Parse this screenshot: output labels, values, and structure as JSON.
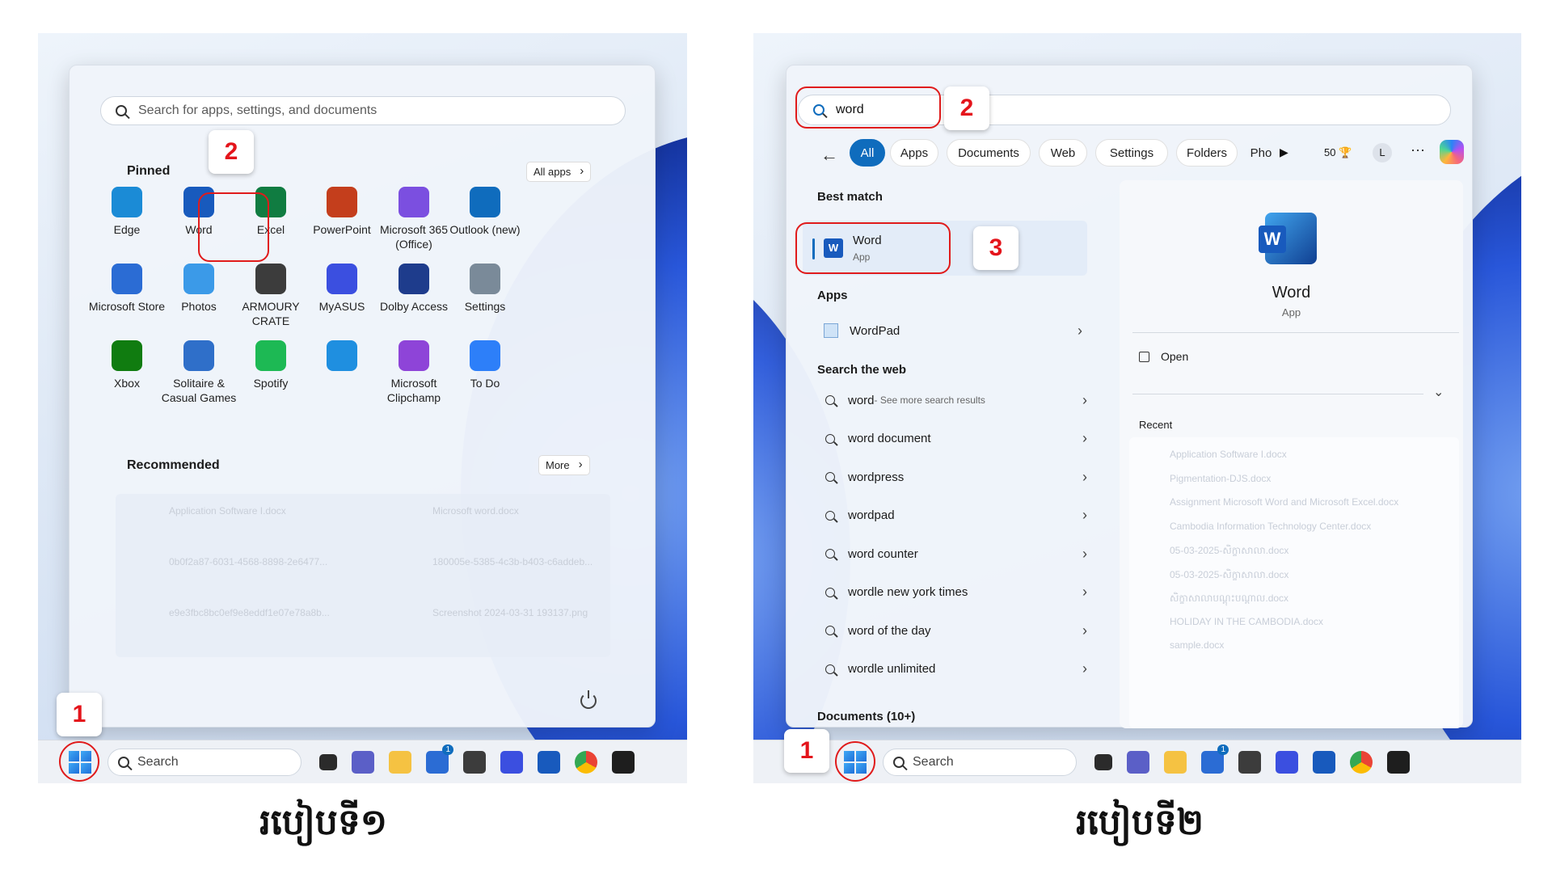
{
  "left": {
    "search_placeholder": "Search for apps, settings, and documents",
    "pinned_label": "Pinned",
    "all_apps_label": "All apps",
    "pinned_apps": [
      {
        "label": "Edge",
        "icon": "edge-icon",
        "color": "#1b8bd6"
      },
      {
        "label": "Word",
        "icon": "word-icon",
        "color": "#185abd"
      },
      {
        "label": "Excel",
        "icon": "excel-icon",
        "color": "#107c41"
      },
      {
        "label": "PowerPoint",
        "icon": "powerpoint-icon",
        "color": "#c43e1c"
      },
      {
        "label": "Microsoft 365 (Office)",
        "icon": "m365-icon",
        "color": "#7b4fe0"
      },
      {
        "label": "Outlook (new)",
        "icon": "outlook-icon",
        "color": "#0f6cbd"
      },
      {
        "label": "Microsoft Store",
        "icon": "store-icon",
        "color": "#2b6cd4"
      },
      {
        "label": "Photos",
        "icon": "photos-icon",
        "color": "#3b9ae8"
      },
      {
        "label": "ARMOURY CRATE",
        "icon": "armoury-icon",
        "color": "#3c3c3c"
      },
      {
        "label": "MyASUS",
        "icon": "myasus-icon",
        "color": "#3b4fe0"
      },
      {
        "label": "Dolby Access",
        "icon": "dolby-icon",
        "color": "#1e3c8c"
      },
      {
        "label": "Settings",
        "icon": "settings-icon",
        "color": "#7a8a99"
      },
      {
        "label": "Xbox",
        "icon": "xbox-icon",
        "color": "#107c10"
      },
      {
        "label": "Solitaire & Casual Games",
        "icon": "solitaire-icon",
        "color": "#2f6fc9"
      },
      {
        "label": "Spotify",
        "icon": "spotify-icon",
        "color": "#1db954"
      },
      {
        "label": "",
        "icon": "camera-app-icon",
        "color": "#1f8fe0"
      },
      {
        "label": "Microsoft Clipchamp",
        "icon": "clipchamp-icon",
        "color": "#8e44d8"
      },
      {
        "label": "To Do",
        "icon": "todo-icon",
        "color": "#2d7ff9"
      }
    ],
    "recommended_label": "Recommended",
    "more_label": "More",
    "recommended": [
      "Application Software I.docx",
      "Microsoft word.docx",
      "0b0f2a87-6031-4568-8898-2e6477...",
      "180005e-5385-4c3b-b403-c6addeb...",
      "e9e3fbc8bc0ef9e8eddf1e07e78a8b...",
      "Screenshot 2024-03-31 193137.png"
    ],
    "badge_1": "1",
    "badge_2": "2",
    "caption": "របៀបទី១"
  },
  "right": {
    "query": "word",
    "filters": [
      "All",
      "Apps",
      "Documents",
      "Web",
      "Settings",
      "Folders",
      "Pho"
    ],
    "points": "50",
    "avatar": "L",
    "best_match_label": "Best match",
    "best_match_title": "Word",
    "best_match_sub": "App",
    "apps_label": "Apps",
    "wordpad": "WordPad",
    "web_label": "Search the web",
    "web_results": [
      {
        "main": "word",
        "extra": " - See more search results"
      },
      {
        "main": "word document",
        "extra": ""
      },
      {
        "main": "wordpress",
        "extra": ""
      },
      {
        "main": "wordpad",
        "extra": ""
      },
      {
        "main": "word counter",
        "extra": ""
      },
      {
        "main": "wordle new york times",
        "extra": ""
      },
      {
        "main": "word of the day",
        "extra": ""
      },
      {
        "main": "wordle unlimited",
        "extra": ""
      }
    ],
    "documents_label": "Documents (10+)",
    "detail_title": "Word",
    "detail_sub": "App",
    "open_label": "Open",
    "recent_label": "Recent",
    "recent_items": [
      "Application Software I.docx",
      "Pigmentation-DJS.docx",
      "Assignment Microsoft Word and Microsoft Excel.docx",
      "Cambodia Information Technology Center.docx",
      "05-03-2025-សិក្ខាសាលា.docx",
      "05-03-2025-សិក្ខាសាលា.docx",
      "សិក្ខាសាលាបណ្តុះបណ្តាល.docx",
      "HOLIDAY IN THE CAMBODIA.docx",
      "sample.docx"
    ],
    "badge_1": "1",
    "badge_2": "2",
    "badge_3": "3",
    "caption": "របៀបទី២"
  },
  "taskbar": {
    "search_label": "Search",
    "store_badge": "1"
  },
  "colors": {
    "accent": "#0f6cbd",
    "highlight": "#e01b1b"
  }
}
